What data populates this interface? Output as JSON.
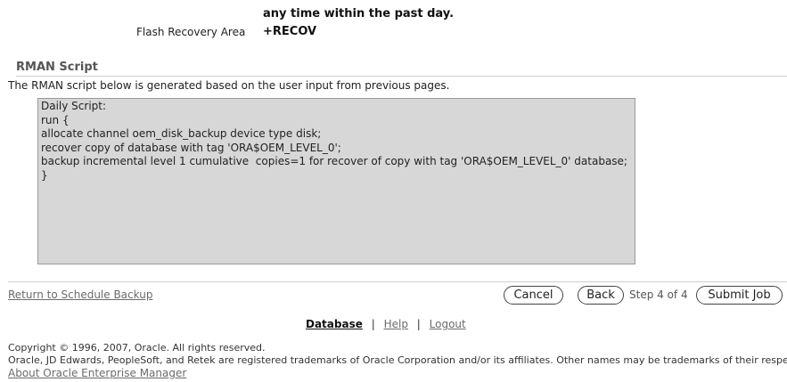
{
  "review": {
    "frequency_tail": "any time within the past day.",
    "flash_label": "Flash Recovery Area",
    "flash_value": "+RECOV"
  },
  "rman": {
    "title": "RMAN Script",
    "description": "The RMAN script below is generated based on the user input from previous pages.",
    "script": "Daily Script:\nrun {\nallocate channel oem_disk_backup device type disk;\nrecover copy of database with tag 'ORA$OEM_LEVEL_0';\nbackup incremental level 1 cumulative  copies=1 for recover of copy with tag 'ORA$OEM_LEVEL_0' database;\n}"
  },
  "actions": {
    "return_link": "Return to Schedule Backup",
    "cancel_label": "Cancel",
    "back_label": "Back",
    "step_text": "Step 4 of 4",
    "submit_label": "Submit Job"
  },
  "footer": {
    "nav_database": "Database",
    "nav_help": "Help",
    "nav_logout": "Logout",
    "separator": "|",
    "copyright": "Copyright © 1996, 2007, Oracle. All rights reserved.",
    "trademarks": "Oracle, JD Edwards, PeopleSoft, and Retek are registered trademarks of Oracle Corporation and/or its affiliates. Other names may be trademarks of their respective owners.",
    "about_link": "About Oracle Enterprise Manager"
  }
}
